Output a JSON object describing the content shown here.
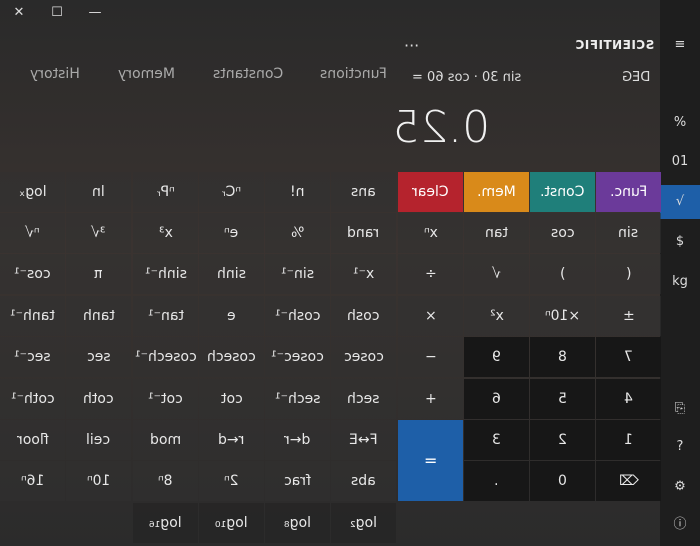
{
  "window": {
    "close_glyph": "✕",
    "maximize_glyph": "☐",
    "minimize_glyph": "—"
  },
  "header": {
    "mode": "SCIENTIFIC",
    "more_glyph": "···",
    "menu_glyph": "☰",
    "angle_unit": "DEG",
    "expression": "sin 30 · cos 60 =",
    "display": "0.25"
  },
  "tabs": [
    "Functions",
    "Constants",
    "Memory",
    "History"
  ],
  "sidebar": [
    "≡",
    "%",
    "01",
    "√",
    "$",
    "kg",
    "⎘",
    "?",
    "⚙",
    "ⓘ"
  ],
  "keys": [
    {
      "label": "logₓ",
      "style": ""
    },
    {
      "label": "ln",
      "style": ""
    },
    {
      "label": "ⁿPᵣ",
      "style": ""
    },
    {
      "label": "ⁿCᵣ",
      "style": ""
    },
    {
      "label": "n!",
      "style": ""
    },
    {
      "label": "ans",
      "style": ""
    },
    {
      "label": "Clear",
      "style": "clear"
    },
    {
      "label": "Mem.",
      "style": "mem"
    },
    {
      "label": "Const.",
      "style": "const"
    },
    {
      "label": "Func.",
      "style": "func"
    },
    {
      "label": "ⁿ√",
      "style": ""
    },
    {
      "label": "³√",
      "style": ""
    },
    {
      "label": "x³",
      "style": ""
    },
    {
      "label": "eⁿ",
      "style": ""
    },
    {
      "label": "%",
      "style": ""
    },
    {
      "label": "rand",
      "style": ""
    },
    {
      "label": "xⁿ",
      "style": ""
    },
    {
      "label": "tan",
      "style": ""
    },
    {
      "label": "cos",
      "style": ""
    },
    {
      "label": "sin",
      "style": ""
    },
    {
      "label": "cos⁻¹",
      "style": ""
    },
    {
      "label": "π",
      "style": ""
    },
    {
      "label": "sinh⁻¹",
      "style": ""
    },
    {
      "label": "sinh",
      "style": ""
    },
    {
      "label": "sin⁻¹",
      "style": ""
    },
    {
      "label": "x⁻¹",
      "style": ""
    },
    {
      "label": "÷",
      "style": ""
    },
    {
      "label": "√",
      "style": ""
    },
    {
      "label": ")",
      "style": ""
    },
    {
      "label": "(",
      "style": ""
    },
    {
      "label": "tanh⁻¹",
      "style": ""
    },
    {
      "label": "tanh",
      "style": ""
    },
    {
      "label": "tan⁻¹",
      "style": ""
    },
    {
      "label": "e",
      "style": ""
    },
    {
      "label": "cosh⁻¹",
      "style": ""
    },
    {
      "label": "cosh",
      "style": ""
    },
    {
      "label": "×",
      "style": ""
    },
    {
      "label": "x²",
      "style": ""
    },
    {
      "label": "×10ⁿ",
      "style": ""
    },
    {
      "label": "±",
      "style": ""
    },
    {
      "label": "sec⁻¹",
      "style": ""
    },
    {
      "label": "sec",
      "style": ""
    },
    {
      "label": "cosech⁻¹",
      "style": ""
    },
    {
      "label": "cosech",
      "style": ""
    },
    {
      "label": "cosec⁻¹",
      "style": ""
    },
    {
      "label": "cosec",
      "style": ""
    },
    {
      "label": "−",
      "style": ""
    },
    {
      "label": "9",
      "style": "dark"
    },
    {
      "label": "8",
      "style": "dark"
    },
    {
      "label": "7",
      "style": "dark"
    },
    {
      "label": "coth⁻¹",
      "style": ""
    },
    {
      "label": "coth",
      "style": ""
    },
    {
      "label": "cot⁻¹",
      "style": ""
    },
    {
      "label": "cot",
      "style": ""
    },
    {
      "label": "sech⁻¹",
      "style": ""
    },
    {
      "label": "sech",
      "style": ""
    },
    {
      "label": "+",
      "style": ""
    },
    {
      "label": "6",
      "style": "dark"
    },
    {
      "label": "5",
      "style": "dark"
    },
    {
      "label": "4",
      "style": "dark"
    },
    {
      "label": "floor",
      "style": ""
    },
    {
      "label": "ceil",
      "style": ""
    },
    {
      "label": "mod",
      "style": ""
    },
    {
      "label": "r←d",
      "style": ""
    },
    {
      "label": "d←r",
      "style": ""
    },
    {
      "label": "F↔E",
      "style": ""
    },
    {
      "label": "3",
      "style": "dark"
    },
    {
      "label": "2",
      "style": "dark"
    },
    {
      "label": "1",
      "style": "dark"
    },
    {
      "label": "16ⁿ",
      "style": ""
    },
    {
      "label": "10ⁿ",
      "style": ""
    },
    {
      "label": "8ⁿ",
      "style": ""
    },
    {
      "label": "2ⁿ",
      "style": ""
    },
    {
      "label": "frac",
      "style": ""
    },
    {
      "label": "abs",
      "style": ""
    },
    {
      "label": ".",
      "style": "dark"
    },
    {
      "label": "0",
      "style": "dark"
    },
    {
      "label": "⌫",
      "style": "dark"
    },
    {
      "label": "=",
      "style": "eq"
    },
    {
      "label": "log₁₆",
      "style": "ghost"
    },
    {
      "label": "log₁₀",
      "style": "ghost"
    },
    {
      "label": "log₈",
      "style": "ghost"
    },
    {
      "label": "log₂",
      "style": "ghost"
    }
  ]
}
